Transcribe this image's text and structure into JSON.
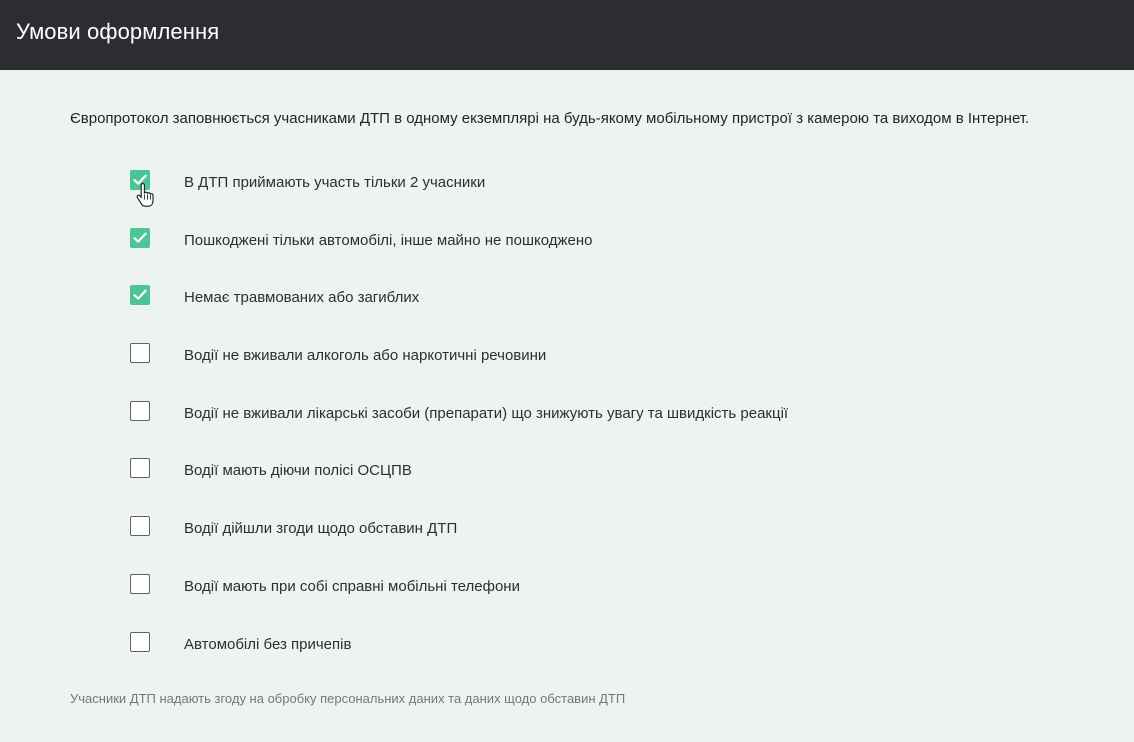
{
  "header": {
    "title": "Умови оформлення"
  },
  "intro_text": "Європротокол заповнюється учасниками ДТП в одному екземплярі на будь-якому мобільному пристрої з камерою та виходом в Інтернет.",
  "conditions": [
    {
      "label": "В ДТП приймають участь тільки 2 учасники",
      "checked": true
    },
    {
      "label": "Пошкоджені тільки автомобілі, інше майно не пошкоджено",
      "checked": true
    },
    {
      "label": "Немає травмованих або загиблих",
      "checked": true
    },
    {
      "label": "Водії не вживали алкоголь або наркотичні речовини",
      "checked": false
    },
    {
      "label": "Водії не вживали лікарські засоби (препарати) що знижують увагу та швидкість реакції",
      "checked": false
    },
    {
      "label": "Водії мають діючи полісі ОСЦПВ",
      "checked": false
    },
    {
      "label": "Водії дійшли згоди щодо обставин ДТП",
      "checked": false
    },
    {
      "label": "Водії мають при собі справні мобільні телефони",
      "checked": false
    },
    {
      "label": "Автомобілі без причепів",
      "checked": false
    }
  ],
  "footnote": "Учасники ДТП надають згоду на обробку персональних даних та даних щодо обставин ДТП",
  "colors": {
    "header_bg": "#2b2d33",
    "page_bg": "#ecf3f1",
    "checkbox_checked": "#4cc496"
  }
}
